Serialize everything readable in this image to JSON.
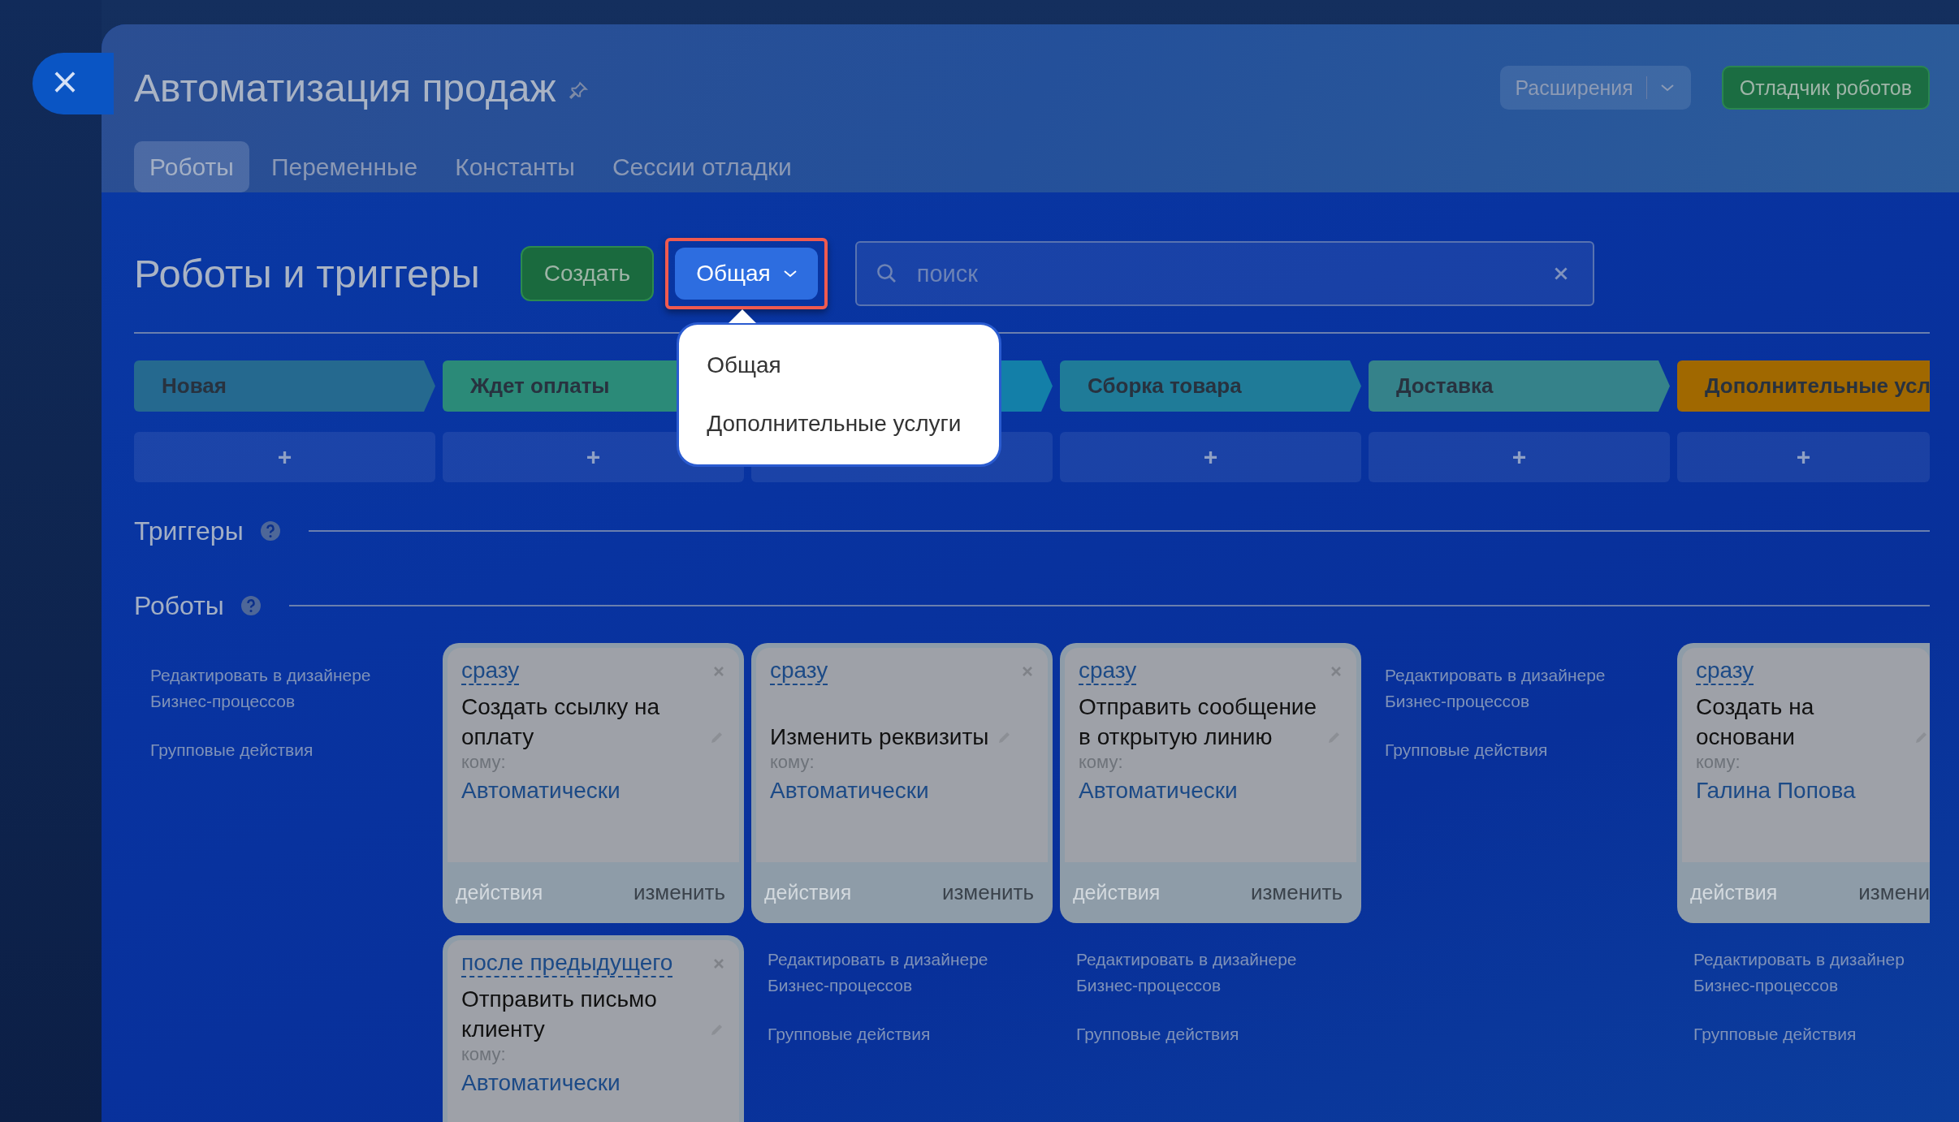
{
  "close_button": {
    "label": "×"
  },
  "header": {
    "title": "Автоматизация продаж",
    "extensions_button": "Расширения",
    "debugger_button": "Отладчик роботов"
  },
  "tabs": [
    {
      "label": "Роботы",
      "selected": true
    },
    {
      "label": "Переменные",
      "selected": false
    },
    {
      "label": "Константы",
      "selected": false
    },
    {
      "label": "Сессии отладки",
      "selected": false
    }
  ],
  "toolbar": {
    "heading": "Роботы и триггеры",
    "create_button": "Создать",
    "filter": {
      "label": "Общая",
      "highlighted": true,
      "menu": [
        "Общая",
        "Дополнительные услуги"
      ]
    },
    "search": {
      "placeholder": "поиск"
    }
  },
  "stages": [
    {
      "name": "Новая",
      "color": "#25698f",
      "add_label": "+"
    },
    {
      "name": "Ждет оплаты",
      "color": "#2b8a78",
      "add_label": "+"
    },
    {
      "color": "#137fa8"
    },
    {
      "name": "Сборка товара",
      "color": "#1f7b98",
      "add_label": "+"
    },
    {
      "name": "Доставка",
      "color": "#35828a",
      "add_label": "+"
    },
    {
      "name": "Дополнительные усл",
      "color": "#a06800",
      "add_label": "+",
      "clipped": true
    }
  ],
  "sections": [
    {
      "title": "Триггеры"
    },
    {
      "title": "Роботы"
    }
  ],
  "columns": [
    {
      "edit_link": "Редактировать в дизайнере Бизнес-процессов",
      "group_link": "Групповые действия"
    },
    {
      "robots": [
        {
          "timing": "сразу",
          "title": "Создать ссылку на оплату",
          "to_label": "кому:",
          "to": "Автоматически",
          "actions": "действия",
          "edit": "изменить"
        },
        {
          "timing": "после предыдущего",
          "title": "Отправить письмо клиенту",
          "to_label": "кому:",
          "to": "Автоматически"
        }
      ]
    },
    {
      "robots": [
        {
          "timing": "сразу",
          "title": "Изменить реквизиты",
          "to_label": "кому:",
          "to": "Автоматически",
          "actions": "действия",
          "edit": "изменить"
        }
      ],
      "edit_link": "Редактировать в дизайнере Бизнес-процессов",
      "group_link": "Групповые действия"
    },
    {
      "robots": [
        {
          "timing": "сразу",
          "title": "Отправить сообщение в открытую линию",
          "to_label": "кому:",
          "to": "Автоматически",
          "actions": "действия",
          "edit": "изменить"
        }
      ],
      "edit_link": "Редактировать в дизайнере Бизнес-процессов",
      "group_link": "Групповые действия"
    },
    {
      "edit_link": "Редактировать в дизайнере Бизнес-процессов",
      "group_link": "Групповые действия"
    },
    {
      "robots": [
        {
          "timing": "сразу",
          "title": "Создать на основани",
          "to_label": "кому:",
          "to": "Галина Попова",
          "actions": "действия",
          "edit": "измени"
        }
      ],
      "edit_link": "Редактировать в дизайнер Бизнес-процессов",
      "group_link": "Групповые действия",
      "clipped": true
    }
  ]
}
